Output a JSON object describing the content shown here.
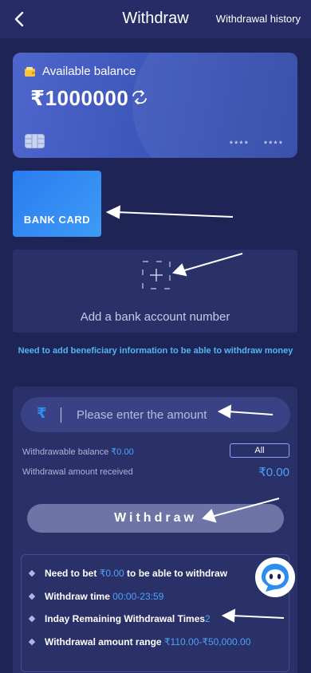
{
  "header": {
    "title": "Withdraw",
    "history_link": "Withdrawal history",
    "back_icon": "chevron-left-icon"
  },
  "balance_card": {
    "label": "Available balance",
    "amount": "₹1000000",
    "card_mask_1": "****",
    "card_mask_2": "****",
    "icons": [
      "wallet-icon",
      "refresh-icon",
      "chip-icon"
    ]
  },
  "payment_method": {
    "selected_label": "BANK CARD"
  },
  "add_account": {
    "label": "Add a bank account number",
    "icon": "plus-icon"
  },
  "notice": "Need to add beneficiary information to be able to withdraw money",
  "amount_input": {
    "currency_symbol": "₹",
    "placeholder": "Please enter the amount",
    "value": ""
  },
  "withdrawable": {
    "label": "Withdrawable balance",
    "value": "₹0.00",
    "all_button": "All"
  },
  "received": {
    "label": "Withdrawal amount received",
    "value": "₹0.00"
  },
  "withdraw_button": "Withdraw",
  "rules": [
    {
      "prefix": "Need to bet ",
      "highlight": "₹0.00",
      "suffix": " to be able to withdraw"
    },
    {
      "prefix": "Withdraw time ",
      "highlight": "00:00-23:59",
      "suffix": ""
    },
    {
      "prefix": "Inday Remaining Withdrawal Times",
      "highlight": "2",
      "suffix": ""
    },
    {
      "prefix": "Withdrawal amount range ",
      "highlight": "₹110.00-₹50,000.00",
      "suffix": ""
    }
  ],
  "support_icon": "chat-bot-icon",
  "colors": {
    "background": "#1f2457",
    "panel": "#2a3068",
    "accent": "#4fa2f7",
    "notice": "#4fb7f4",
    "card_gradient_start": "#4f66cc",
    "bank_tab": "#2b7bf0",
    "withdraw_button": "#6e74a6"
  }
}
